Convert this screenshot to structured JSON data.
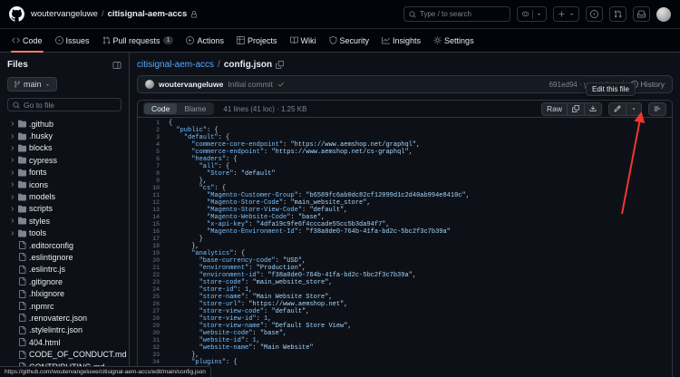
{
  "header": {
    "owner": "woutervangeluwe",
    "separator": "/",
    "repo": "citisignal-aem-accs",
    "search_placeholder": "Type / to search"
  },
  "nav_tabs": [
    {
      "label": "Code",
      "icon": "code",
      "active": true
    },
    {
      "label": "Issues",
      "icon": "issue"
    },
    {
      "label": "Pull requests",
      "icon": "pr",
      "badge": "1"
    },
    {
      "label": "Actions",
      "icon": "play"
    },
    {
      "label": "Projects",
      "icon": "table"
    },
    {
      "label": "Wiki",
      "icon": "book"
    },
    {
      "label": "Security",
      "icon": "shield"
    },
    {
      "label": "Insights",
      "icon": "graph"
    },
    {
      "label": "Settings",
      "icon": "gear"
    }
  ],
  "sidebar": {
    "title": "Files",
    "branch": "main",
    "goto_placeholder": "Go to file",
    "tree": [
      {
        "name": ".github",
        "type": "folder"
      },
      {
        "name": ".husky",
        "type": "folder"
      },
      {
        "name": "blocks",
        "type": "folder"
      },
      {
        "name": "cypress",
        "type": "folder"
      },
      {
        "name": "fonts",
        "type": "folder"
      },
      {
        "name": "icons",
        "type": "folder"
      },
      {
        "name": "models",
        "type": "folder"
      },
      {
        "name": "scripts",
        "type": "folder"
      },
      {
        "name": "styles",
        "type": "folder"
      },
      {
        "name": "tools",
        "type": "folder"
      },
      {
        "name": ".editorconfig",
        "type": "file"
      },
      {
        "name": ".eslintignore",
        "type": "file"
      },
      {
        "name": ".eslintrc.js",
        "type": "file"
      },
      {
        "name": ".gitignore",
        "type": "file"
      },
      {
        "name": ".hlxignore",
        "type": "file"
      },
      {
        "name": ".npmrc",
        "type": "file"
      },
      {
        "name": ".renovaterc.json",
        "type": "file"
      },
      {
        "name": ".stylelintrc.json",
        "type": "file"
      },
      {
        "name": "404.html",
        "type": "file"
      },
      {
        "name": "CODE_OF_CONDUCT.md",
        "type": "file"
      },
      {
        "name": "CONTRIBUTING.md",
        "type": "file"
      }
    ]
  },
  "file_view": {
    "breadcrumb_repo": "citisignal-aem-accs",
    "breadcrumb_sep": "/",
    "breadcrumb_file": "config.json",
    "commit": {
      "author": "woutervangeluwe",
      "message": "Initial commit",
      "sha_time": "691ed94 · yesterday",
      "history_label": "History"
    },
    "toolbar": {
      "code_label": "Code",
      "blame_label": "Blame",
      "stats": "41 lines (41 loc) · 1.25 KB",
      "raw_label": "Raw"
    },
    "tooltip": "Edit this file",
    "code_lines": [
      "{",
      "  \"public\": {",
      "    \"default\": {",
      "      \"commerce-core-endpoint\": \"https://www.aemshop.net/graphql\",",
      "      \"commerce-endpoint\": \"https://www.aemshop.net/cs-graphql\",",
      "      \"headers\": {",
      "        \"all\": {",
      "          \"Store\": \"default\"",
      "        },",
      "        \"cs\": {",
      "          \"Magento-Customer-Group\": \"b6589fc6ab0dc82cf12099d1c2d40ab994e8410c\",",
      "          \"Magento-Store-Code\": \"main_website_store\",",
      "          \"Magento-Store-View-Code\": \"default\",",
      "          \"Magento-Website-Code\": \"base\",",
      "          \"x-api-key\": \"4dfa19c9fe6f4cccade55cc5b3da94f7\",",
      "          \"Magento-Environment-Id\": \"f38a0de0-764b-41fa-bd2c-5bc2f3c7b39a\"",
      "        }",
      "      },",
      "      \"analytics\": {",
      "        \"base-currency-code\": \"USD\",",
      "        \"environment\": \"Production\",",
      "        \"environment-id\": \"f38a0de0-764b-41fa-bd2c-5bc2f3c7b39a\",",
      "        \"store-code\": \"main_website_store\",",
      "        \"store-id\": 1,",
      "        \"store-name\": \"Main Website Store\",",
      "        \"store-url\": \"https://www.aemshop.net\",",
      "        \"store-view-code\": \"default\",",
      "        \"store-view-id\": 1,",
      "        \"store-view-name\": \"Default Store View\",",
      "        \"website-code\": \"base\",",
      "        \"website-id\": 1,",
      "        \"website-name\": \"Main Website\"",
      "      },",
      "      \"plugins\": {"
    ]
  },
  "status_bar_url": "https://github.com/woutervangeluwe/citisignal-aem-accs/edit/main/config.json"
}
